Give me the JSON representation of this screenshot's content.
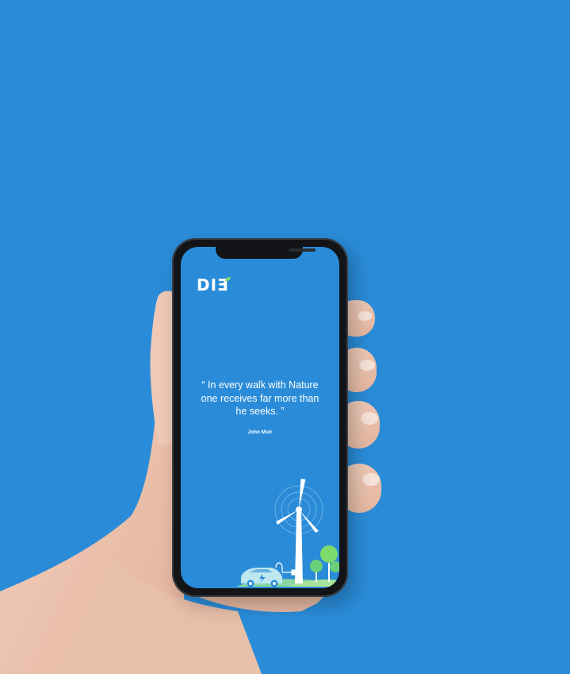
{
  "background_color": "#2a8cd8",
  "app": {
    "logo_text": "DI",
    "logo_accent": "Ǝ",
    "quote": "“ In every walk with Nature one receives far more than he seeks. ”",
    "author": "John Muir"
  },
  "illustration": {
    "elements": [
      "wind-turbine",
      "electric-car",
      "charging-plug",
      "trees"
    ],
    "accent_color": "#7ddc6b"
  }
}
